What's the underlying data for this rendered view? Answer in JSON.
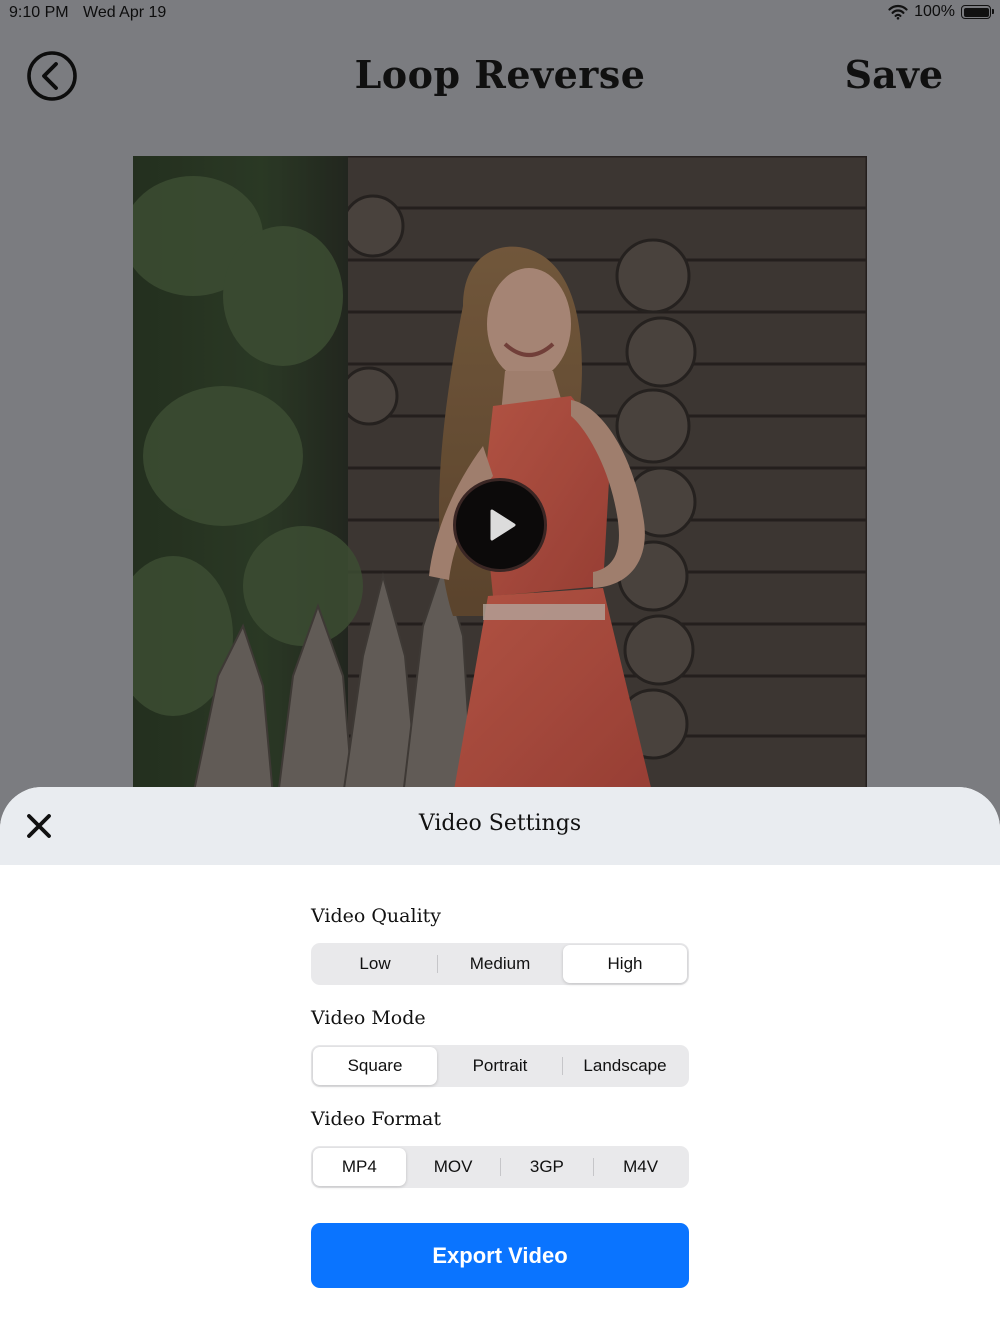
{
  "status_bar": {
    "time": "9:10 PM",
    "date": "Wed Apr 19",
    "battery": "100%",
    "icons": [
      "wifi-icon",
      "battery-icon"
    ]
  },
  "nav": {
    "back_icon": "back-circle-icon",
    "title": "Loop Reverse",
    "save_label": "Save"
  },
  "player": {
    "play_icon": "play-icon"
  },
  "sheet": {
    "close_icon": "close-icon",
    "title": "Video Settings",
    "quality": {
      "label": "Video Quality",
      "options": [
        "Low",
        "Medium",
        "High"
      ],
      "selected": "High"
    },
    "mode": {
      "label": "Video Mode",
      "options": [
        "Square",
        "Portrait",
        "Landscape"
      ],
      "selected": "Square"
    },
    "format": {
      "label": "Video Format",
      "options": [
        "MP4",
        "MOV",
        "3GP",
        "M4V"
      ],
      "selected": "MP4"
    },
    "export_label": "Export Video"
  },
  "colors": {
    "background": "#7b7c80",
    "sheet_header": "#e9ecf0",
    "accent": "#0a74ff",
    "dress": "#d86050"
  }
}
